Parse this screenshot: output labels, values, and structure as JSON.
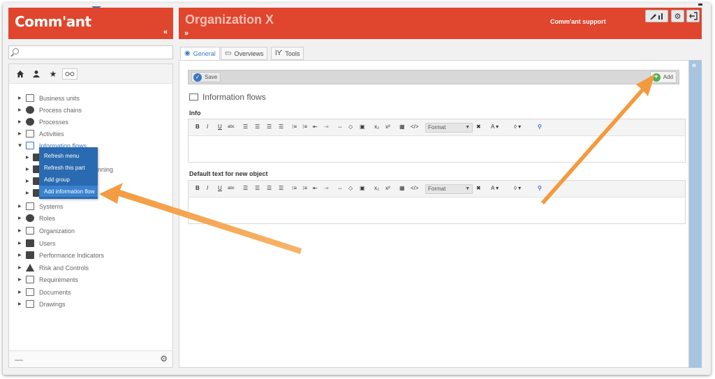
{
  "header": {
    "logo_text": "Comm'ant",
    "logo_collapse": "«",
    "org_title": "Organization X",
    "org_expand": "»",
    "support_label": "Comm'ant support",
    "edit_icon": "pencil-chart-icon",
    "settings_icon": "gear-icon",
    "exit_icon": "exit-icon"
  },
  "search": {
    "placeholder": "",
    "value": ""
  },
  "sidebar": {
    "icons": [
      "home-icon",
      "user-icon",
      "star-icon",
      "link-icon"
    ],
    "items": [
      {
        "label": "Business units",
        "icon": "org-icon"
      },
      {
        "label": "Process chains",
        "icon": "gear-circle-icon"
      },
      {
        "label": "Processes",
        "icon": "gears-icon"
      },
      {
        "label": "Activities",
        "icon": "activity-icon"
      },
      {
        "label": "Information flows",
        "icon": "flow-icon",
        "expanded": true
      },
      {
        "label": "Systems",
        "icon": "monitor-icon"
      },
      {
        "label": "Roles",
        "icon": "role-icon"
      },
      {
        "label": "Organization",
        "icon": "organization-icon"
      },
      {
        "label": "Users",
        "icon": "users-icon"
      },
      {
        "label": "Performance Indicators",
        "icon": "chart-icon"
      },
      {
        "label": "Risk and Controls",
        "icon": "warning-icon"
      },
      {
        "label": "Requirements",
        "icon": "document-icon"
      },
      {
        "label": "Documents",
        "icon": "file-icon"
      },
      {
        "label": "Drawings",
        "icon": "drawing-icon"
      }
    ],
    "children": [
      {
        "label": ""
      },
      {
        "label": "nning"
      },
      {
        "label": ""
      },
      {
        "label": ""
      }
    ],
    "footer_minus": "—",
    "footer_gear": "⚙"
  },
  "context_menu": {
    "items": [
      "Refresh menu",
      "Refresh this part",
      "Add group",
      "Add information flow"
    ]
  },
  "tabs": [
    {
      "label": "General",
      "icon": "cube-icon"
    },
    {
      "label": "Overviews",
      "icon": "overview-icon"
    },
    {
      "label": "Tools",
      "icon": "tools-icon"
    }
  ],
  "toolbar": {
    "save_label": "Save",
    "add_label": "Add"
  },
  "content": {
    "section_title": "Information flows",
    "info_label": "Info",
    "default_text_label": "Default text for new object",
    "format_label": "Format",
    "collapse": "«"
  },
  "colors": {
    "brand": "#e0452d",
    "accent": "#3a77c2",
    "arrow": "#f39a3e"
  }
}
